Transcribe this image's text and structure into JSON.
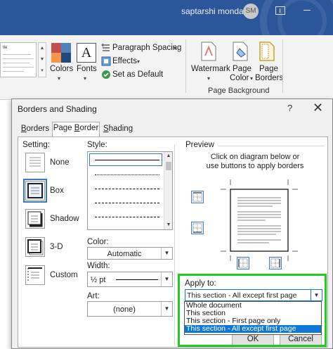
{
  "titlebar": {
    "username": "saptarshi mondal",
    "avatar_initials": "SM"
  },
  "ribbon": {
    "thumbnail_text": "tle",
    "colors_label": "Colors",
    "fonts_label": "Fonts",
    "fonts_icon_letter": "A",
    "paragraph_spacing_label": "Paragraph Spacing",
    "effects_label": "Effects",
    "set_as_default_label": "Set as Default",
    "watermark_label": "Watermark",
    "page_color_line1": "Page",
    "page_color_line2": "Color",
    "page_borders_line1": "Page",
    "page_borders_line2": "Borders",
    "group_label": "Page Background",
    "theme_colors": [
      "#c0504d",
      "#4f81bd",
      "#f79646",
      "#1f497d"
    ]
  },
  "dialog": {
    "title": "Borders and Shading",
    "help": "?",
    "close": "✕",
    "tabs": [
      {
        "label": "Borders",
        "active": false
      },
      {
        "label": "Page Border",
        "active": true
      },
      {
        "label": "Shading",
        "active": false
      }
    ],
    "setting": {
      "label": "Setting:",
      "options": [
        {
          "label": "None",
          "selected": false
        },
        {
          "label": "Box",
          "selected": true
        },
        {
          "label": "Shadow",
          "selected": false
        },
        {
          "label": "3-D",
          "selected": false
        },
        {
          "label": "Custom",
          "selected": false
        }
      ]
    },
    "style": {
      "label": "Style:"
    },
    "color": {
      "label": "Color:",
      "value": "Automatic"
    },
    "width": {
      "label": "Width:",
      "value": "½ pt"
    },
    "art": {
      "label": "Art:",
      "value": "(none)"
    },
    "preview": {
      "label": "Preview",
      "instruction_line1": "Click on diagram below or",
      "instruction_line2": "use buttons to apply borders"
    },
    "apply_to": {
      "label": "Apply to:",
      "value": "This section - All except first page",
      "options": [
        {
          "label": "Whole document",
          "selected": false
        },
        {
          "label": "This section",
          "selected": false
        },
        {
          "label": "This section - First page only",
          "selected": false
        },
        {
          "label": "This section - All except first page",
          "selected": true
        }
      ]
    },
    "ok_label": "OK",
    "cancel_label": "Cancel"
  },
  "colors": {
    "titlebar": "#2b579a",
    "highlight": "#22cc22",
    "selection": "#0f78d7"
  }
}
